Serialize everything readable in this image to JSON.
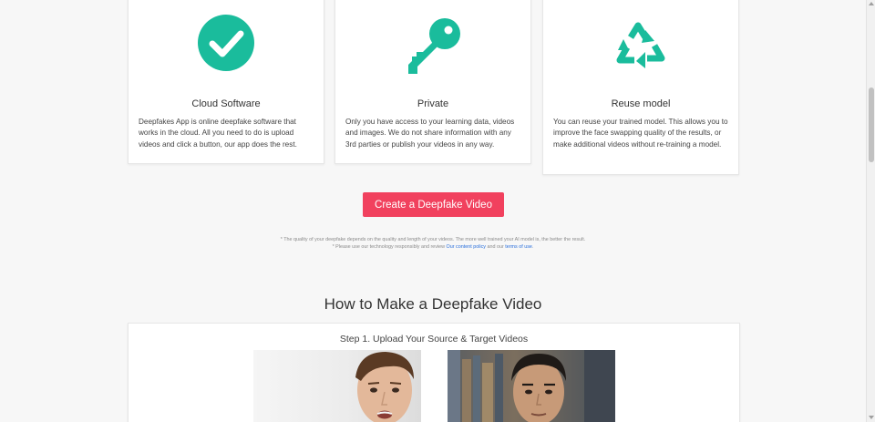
{
  "features": [
    {
      "icon": "checkmark-circle-icon",
      "title": "Cloud Software",
      "description": "Deepfakes App is online deepfake software that works in the cloud. All you need to do is upload videos and click a button, our app does the rest."
    },
    {
      "icon": "key-icon",
      "title": "Private",
      "description": "Only you have access to your learning data, videos and images. We do not share information with any 3rd parties or publish your videos in any way."
    },
    {
      "icon": "recycle-icon",
      "title": "Reuse model",
      "description": "You can reuse your trained model. This allows you to improve the face swapping quality of the results, or make additional videos without re-training a model."
    }
  ],
  "cta": {
    "label": "Create a Deepfake Video"
  },
  "disclaimer": {
    "line1": "* The quality of your deepfake depends on the quality and length of your videos. The more well trained your AI model is, the better the result.",
    "line2_prefix": "* Please use our technology responsibly and review ",
    "content_policy_link": "Our content policy",
    "line2_middle": " and our ",
    "terms_link": "terms of use",
    "line2_suffix": "."
  },
  "how_to": {
    "title": "How to Make a Deepfake Video",
    "step1_title": "Step 1. Upload Your Source & Target Videos"
  },
  "colors": {
    "accent_teal": "#1abc9c",
    "cta_red": "#f1415e",
    "link_blue": "#2a6fdb"
  }
}
